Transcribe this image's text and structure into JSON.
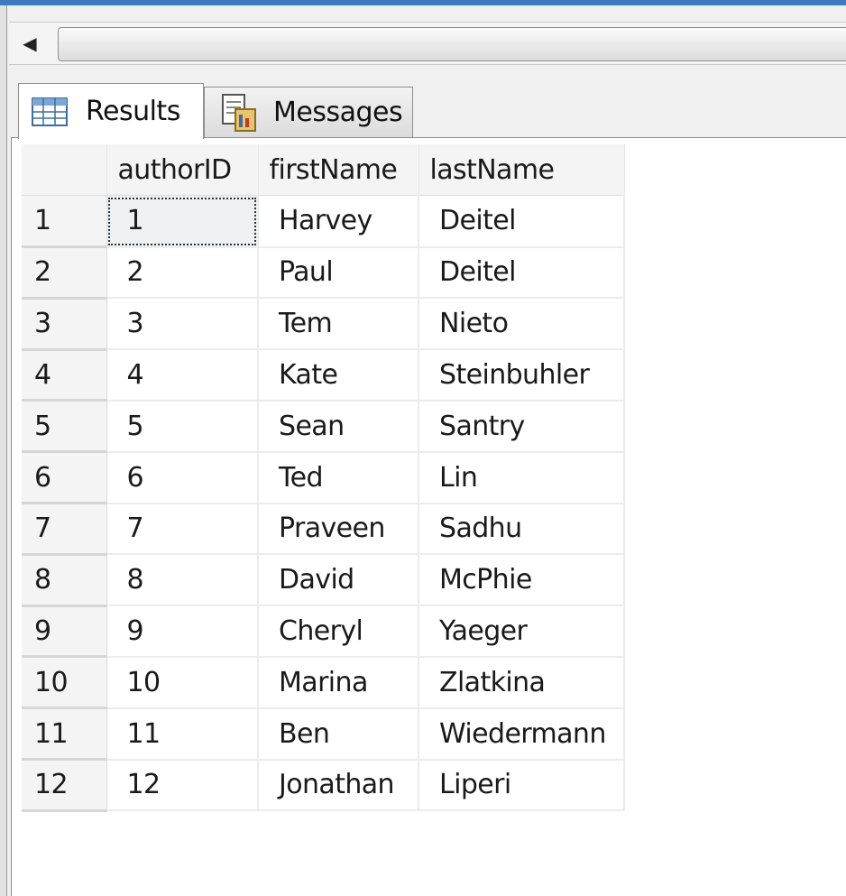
{
  "tabs": [
    {
      "label": "Results",
      "icon": "grid-icon",
      "active": true
    },
    {
      "label": "Messages",
      "icon": "messages-icon",
      "active": false
    }
  ],
  "scrollbar": {
    "left_arrow_icon": "chevron-left-icon"
  },
  "grid": {
    "columns": [
      "authorID",
      "firstName",
      "lastName"
    ],
    "rows": [
      {
        "num": "1",
        "authorID": "1",
        "firstName": "Harvey",
        "lastName": "Deitel"
      },
      {
        "num": "2",
        "authorID": "2",
        "firstName": "Paul",
        "lastName": "Deitel"
      },
      {
        "num": "3",
        "authorID": "3",
        "firstName": "Tem",
        "lastName": "Nieto"
      },
      {
        "num": "4",
        "authorID": "4",
        "firstName": "Kate",
        "lastName": "Steinbuhler"
      },
      {
        "num": "5",
        "authorID": "5",
        "firstName": "Sean",
        "lastName": "Santry"
      },
      {
        "num": "6",
        "authorID": "6",
        "firstName": "Ted",
        "lastName": "Lin"
      },
      {
        "num": "7",
        "authorID": "7",
        "firstName": "Praveen",
        "lastName": "Sadhu"
      },
      {
        "num": "8",
        "authorID": "8",
        "firstName": "David",
        "lastName": "McPhie"
      },
      {
        "num": "9",
        "authorID": "9",
        "firstName": "Cheryl",
        "lastName": "Yaeger"
      },
      {
        "num": "10",
        "authorID": "10",
        "firstName": "Marina",
        "lastName": "Zlatkina"
      },
      {
        "num": "11",
        "authorID": "11",
        "firstName": "Ben",
        "lastName": "Wiedermann"
      },
      {
        "num": "12",
        "authorID": "12",
        "firstName": "Jonathan",
        "lastName": "Liperi"
      }
    ]
  },
  "colors": {
    "title_bar": "#3d7bbf",
    "header_bg": "#f4f4f4",
    "grid_line": "#ececec"
  }
}
